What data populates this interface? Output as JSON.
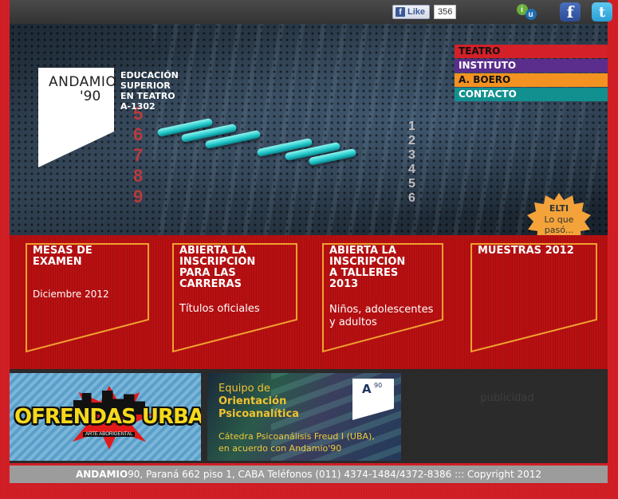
{
  "social": {
    "like_label": "Like",
    "like_count": "356",
    "iu_letters": [
      "i",
      "u"
    ],
    "facebook_letter": "f",
    "twitter_letter": "t"
  },
  "logo": {
    "name": "ANDAMIO",
    "year": "'90",
    "lines": [
      "EDUCACIÓN",
      "SUPERIOR",
      "EN TEATRO",
      "A-1302"
    ]
  },
  "menu": [
    {
      "label": "TEATRO",
      "bg": "#d42028",
      "color": "#111111"
    },
    {
      "label": "INSTITUTO",
      "bg": "#5b2d8c",
      "color": "#ffffff"
    },
    {
      "label": "A. BOERO",
      "bg": "#f39221",
      "color": "#111111"
    },
    {
      "label": "CONTACTO",
      "bg": "#12908f",
      "color": "#ffffff"
    }
  ],
  "badge": {
    "title": "ELTI",
    "text": "Lo que\npasó...",
    "color": "#f3a33a"
  },
  "cards": [
    {
      "title": "MESAS DE\nEXAMEN",
      "sub": "Diciembre 2012"
    },
    {
      "title": "ABIERTA LA\nINSCRIPCION\nPARA LAS\nCARRERAS",
      "sub": "Títulos oficiales"
    },
    {
      "title": "ABIERTA LA\nINSCRIPCION\nA TALLERES\n2013",
      "sub": "Niños, adolescentes\ny adultos"
    },
    {
      "title": "MUESTRAS 2012",
      "sub": ""
    }
  ],
  "card_border_color": "#f0a030",
  "banner1": {
    "word": "OFRENDAS URBANAS",
    "tag": "ARTE ABORIGENTAL"
  },
  "banner2": {
    "line1": "Equipo de",
    "line2": "Orientación\nPsicoanalítica",
    "line3": "Cátedra Psicoanálisis Freud I (UBA),\nen acuerdo con Andamio'90",
    "logo_letter": "A",
    "logo_sup": "90"
  },
  "ad": {
    "label": "publicidad"
  },
  "footer": {
    "brand": "ANDAMIO",
    "text": "90, Paraná 662 piso 1, CABA Teléfonos (011) 4374-1484/4372-8386 ::: Copyright 2012"
  }
}
